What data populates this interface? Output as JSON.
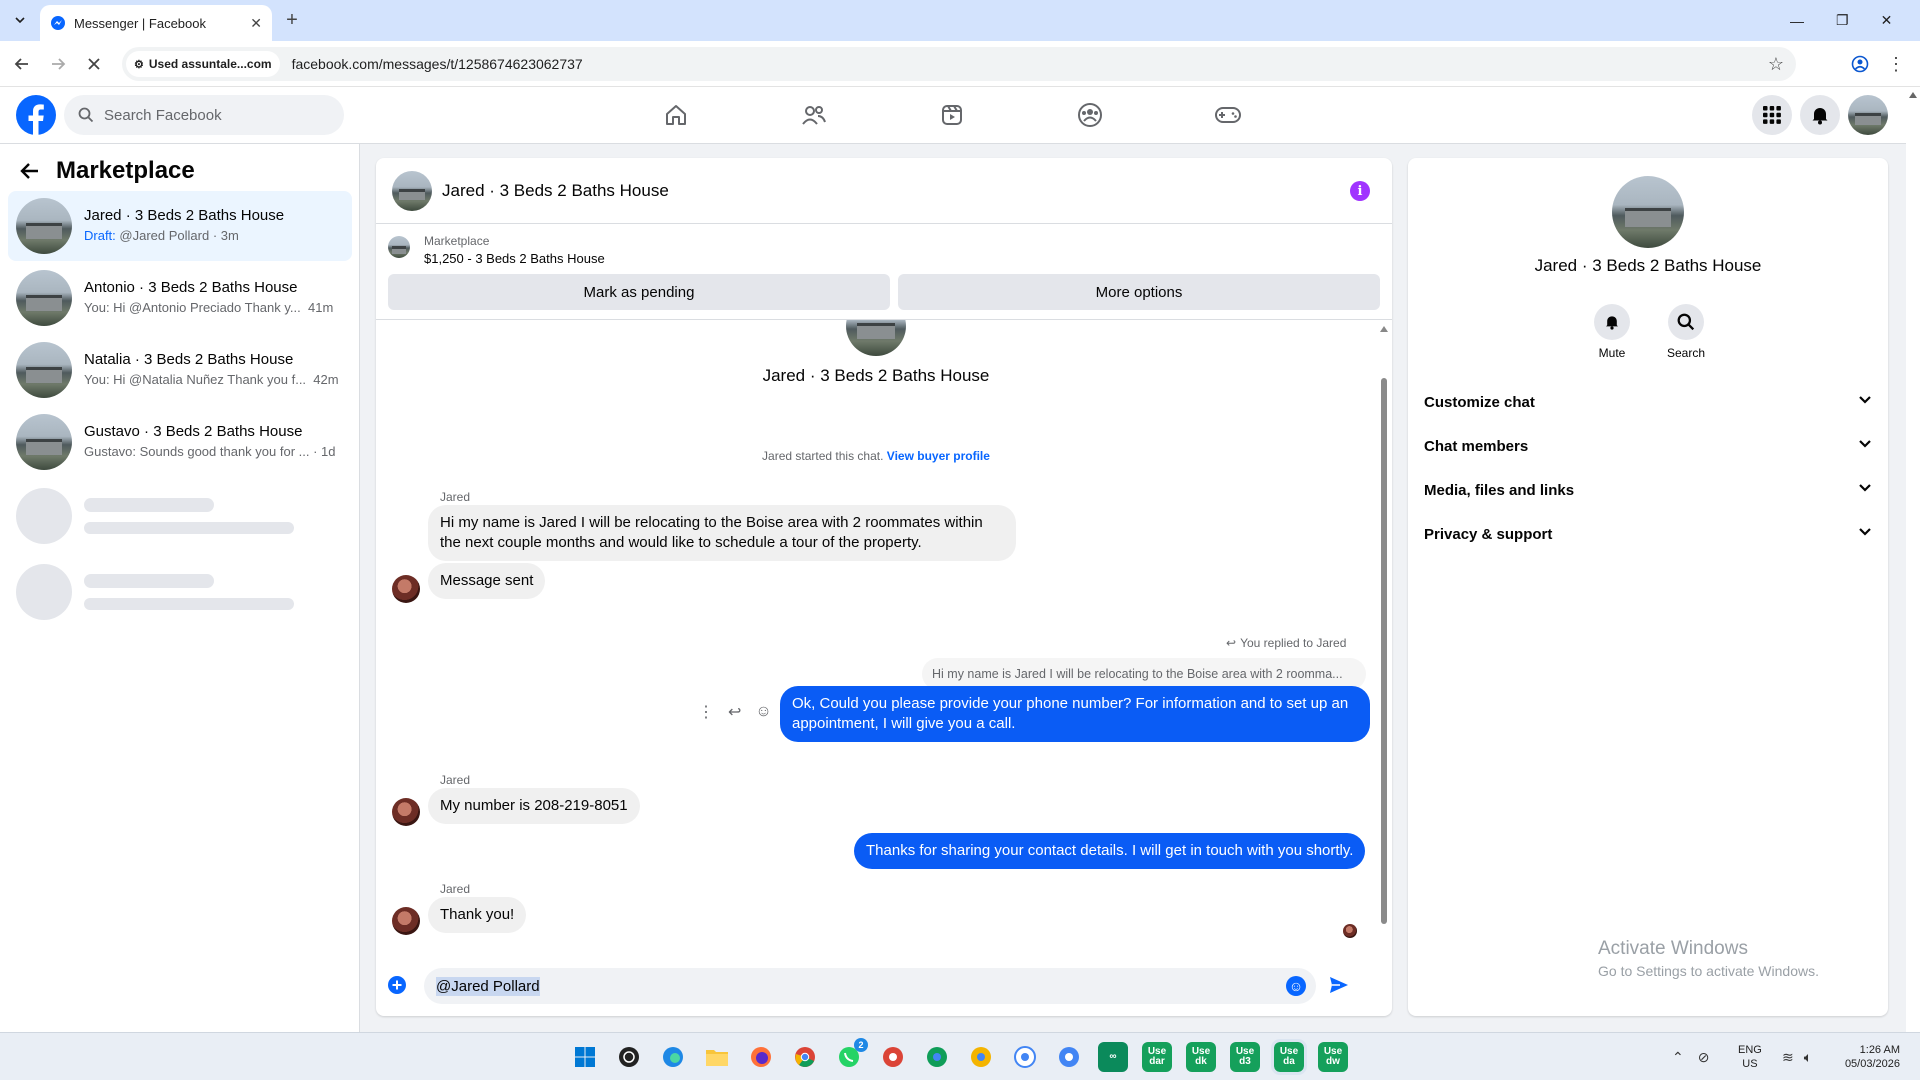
{
  "browser": {
    "tab_title": "Messenger | Facebook",
    "site_info": "Used assuntale...com",
    "url": "facebook.com/messages/t/1258674623062737"
  },
  "fb": {
    "search_placeholder": "Search Facebook"
  },
  "sidebar": {
    "title": "Marketplace",
    "conversations": [
      {
        "title": "Jared · 3 Beds 2 Baths House",
        "draft_label": "Draft:",
        "preview": " @Jared Pollard",
        "time": "3m"
      },
      {
        "title": "Antonio · 3 Beds 2 Baths House",
        "preview": "You: Hi @Antonio Preciado Thank y...",
        "time": "41m"
      },
      {
        "title": "Natalia · 3 Beds 2 Baths House",
        "preview": "You: Hi @Natalia Nuñez Thank you f...",
        "time": "42m"
      },
      {
        "title": "Gustavo · 3 Beds 2 Baths House",
        "preview": "Gustavo: Sounds good thank you for ...",
        "time": "1d"
      }
    ]
  },
  "chat": {
    "header_title": "Jared · 3 Beds 2 Baths House",
    "listing_source": "Marketplace",
    "listing_summary": "$1,250 - 3 Beds 2 Baths House",
    "mark_pending": "Mark as pending",
    "more_options": "More options",
    "intro_title": "Jared · 3 Beds 2 Baths House",
    "started_text": "Jared started this chat.",
    "view_profile": "View buyer profile",
    "messages": {
      "m1_sender": "Jared",
      "m1_text": "Hi my name is Jared I will be relocating to the Boise area with 2 roommates within the next couple months and would like to schedule a tour of the property.",
      "m2_text": "Message sent",
      "reply_label": "You replied to Jared",
      "reply_quote": "Hi my name is Jared I will be relocating to the Boise area with 2 roomma...",
      "m3_text": "Ok, Could you please provide your phone number? For information and to set up an appointment, I will give you a call.",
      "m4_sender": "Jared",
      "m4_text": "My number is 208-219-8051",
      "m5_text": "Thanks for sharing your contact details. I will get in touch with you shortly.",
      "m6_sender": "Jared",
      "m6_text": "Thank you!"
    },
    "composer_value": "@Jared Pollard"
  },
  "right_panel": {
    "title": "Jared · 3 Beds 2 Baths House",
    "mute": "Mute",
    "search": "Search",
    "sections": [
      "Customize chat",
      "Chat members",
      "Media, files and links",
      "Privacy & support"
    ],
    "watermark_title": "Activate Windows",
    "watermark_sub": "Go to Settings to activate Windows."
  },
  "taskbar": {
    "lang": "ENG",
    "region": "US",
    "time": "1:26 AM",
    "date": "05/03/2026",
    "whatsapp_badge": "2",
    "use_labels": [
      "Use dar",
      "Use dk",
      "Use d3",
      "Use da",
      "Use dw"
    ]
  },
  "colors": {
    "fb_blue": "#0866ff",
    "my_bubble": "#0a5cf5",
    "active_conv": "#ebf5ff",
    "info_purple": "#a033ff"
  }
}
